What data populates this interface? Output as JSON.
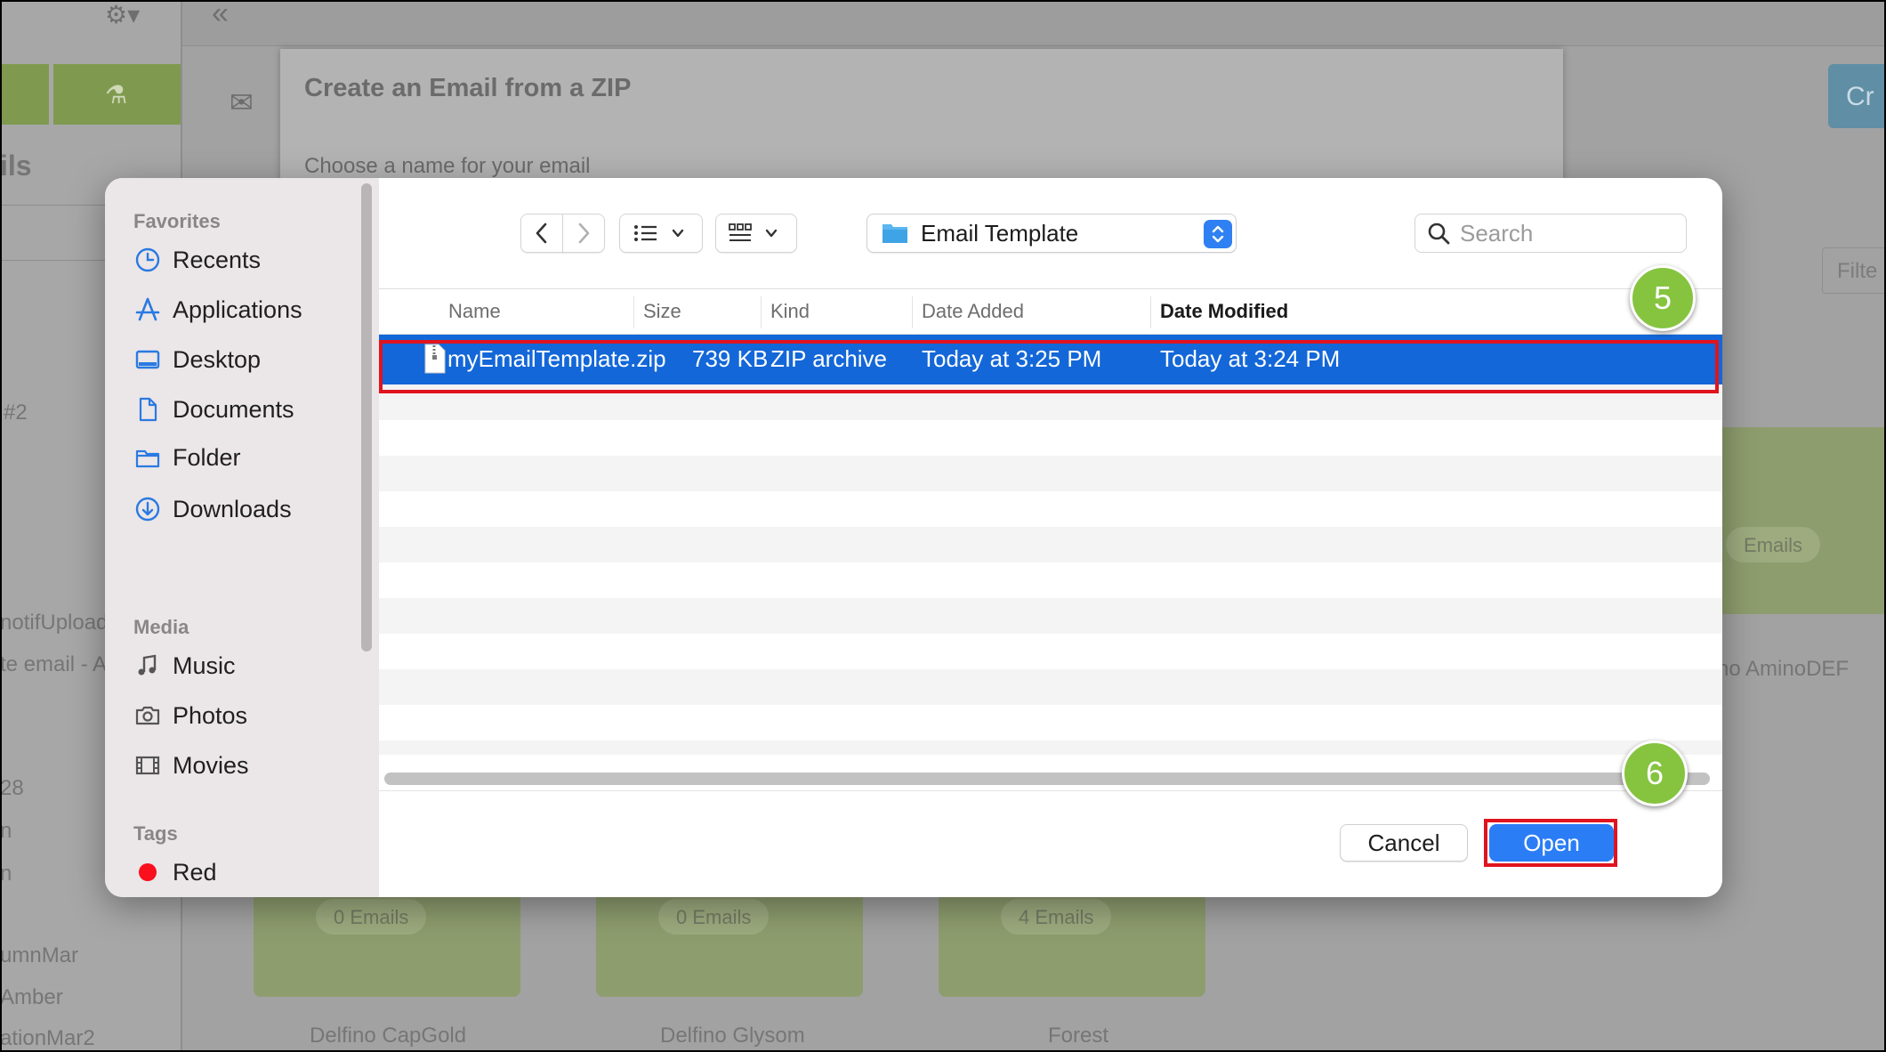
{
  "background": {
    "sidebar_fragments": [
      "ils",
      "#2",
      "notifUpload",
      "te email - A",
      "28",
      "n",
      "n",
      "umnMar",
      "Amber",
      "ationMar2"
    ],
    "zip_title": "Create an Email from a ZIP",
    "zip_subtitle": "Choose a name for your email",
    "create_button": "Cr",
    "filter_text": "Filte",
    "folder_right_count": "Emails",
    "folder_right_name": "no AminoDEF",
    "folders": [
      {
        "count": "0 Emails",
        "name": "Delfino CapGold"
      },
      {
        "count": "0 Emails",
        "name": "Delfino Glysom"
      },
      {
        "count": "4 Emails",
        "name": "Forest"
      }
    ]
  },
  "dialog": {
    "sidebar": {
      "favorites_heading": "Favorites",
      "favorites": [
        {
          "label": "Recents",
          "icon": "clock-icon"
        },
        {
          "label": "Applications",
          "icon": "applications-icon"
        },
        {
          "label": "Desktop",
          "icon": "desktop-icon"
        },
        {
          "label": "Documents",
          "icon": "document-icon"
        },
        {
          "label": "Folder",
          "icon": "folder-icon"
        },
        {
          "label": "Downloads",
          "icon": "download-icon"
        }
      ],
      "media_heading": "Media",
      "media": [
        {
          "label": "Music",
          "icon": "music-icon"
        },
        {
          "label": "Photos",
          "icon": "camera-icon"
        },
        {
          "label": "Movies",
          "icon": "film-icon"
        }
      ],
      "tags_heading": "Tags",
      "tags": [
        {
          "label": "Red",
          "color": "#fa0f1c"
        }
      ]
    },
    "toolbar": {
      "location": "Email Template",
      "search_placeholder": "Search"
    },
    "columns": [
      "Name",
      "Size",
      "Kind",
      "Date Added",
      "Date Modified"
    ],
    "sorted_column": "Date Modified",
    "files": [
      {
        "name": "myEmailTemplate.zip",
        "size": "739 KB",
        "kind": "ZIP archive",
        "date_added": "Today at 3:25 PM",
        "date_modified": "Today at 3:24 PM",
        "selected": true
      }
    ],
    "cancel_label": "Cancel",
    "open_label": "Open"
  },
  "annotations": {
    "step_5": "5",
    "step_6": "6",
    "highlight_color": "#e0141e",
    "badge_color": "#86c440"
  }
}
